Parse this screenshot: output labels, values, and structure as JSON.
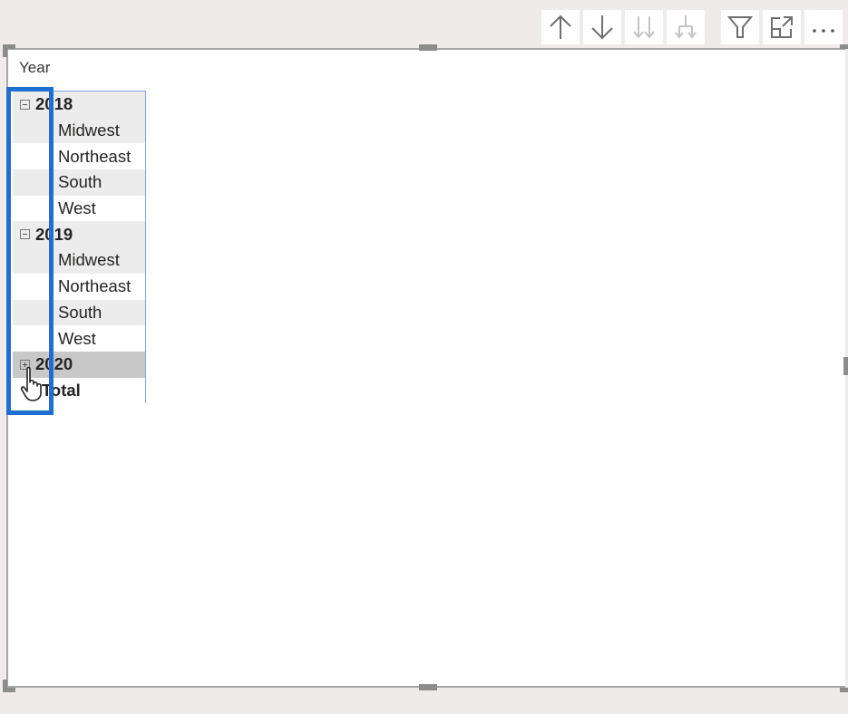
{
  "toolbar": {
    "buttons": [
      {
        "name": "drill-up",
        "icon": "arrow-up-icon",
        "enabled": true
      },
      {
        "name": "drill-down",
        "icon": "arrow-down-icon",
        "enabled": true
      },
      {
        "name": "next-level",
        "icon": "double-arrow-down-icon",
        "enabled": false
      },
      {
        "name": "expand-next-level",
        "icon": "fork-arrow-down-icon",
        "enabled": false
      },
      {
        "name": "filter",
        "icon": "funnel-icon",
        "enabled": true
      },
      {
        "name": "focus-mode",
        "icon": "expand-icon",
        "enabled": true
      },
      {
        "name": "more-options",
        "icon": "ellipsis-icon",
        "enabled": true
      }
    ]
  },
  "visual": {
    "column_header": "Year",
    "rows": [
      {
        "type": "year",
        "label": "2018",
        "expanded": true
      },
      {
        "type": "sub",
        "label": "Midwest"
      },
      {
        "type": "sub",
        "label": "Northeast"
      },
      {
        "type": "sub",
        "label": "South"
      },
      {
        "type": "sub",
        "label": "West"
      },
      {
        "type": "year",
        "label": "2019",
        "expanded": true
      },
      {
        "type": "sub",
        "label": "Midwest"
      },
      {
        "type": "sub",
        "label": "Northeast"
      },
      {
        "type": "sub",
        "label": "South"
      },
      {
        "type": "sub",
        "label": "West"
      },
      {
        "type": "year",
        "label": "2020",
        "expanded": false,
        "hovered": true
      },
      {
        "type": "total",
        "label": "Total"
      }
    ]
  },
  "colors": {
    "highlight": "#1f6fd1",
    "matrix_border": "#7aa6d6",
    "row_shade": "#ececec",
    "row_hover": "#c8c8c8"
  }
}
